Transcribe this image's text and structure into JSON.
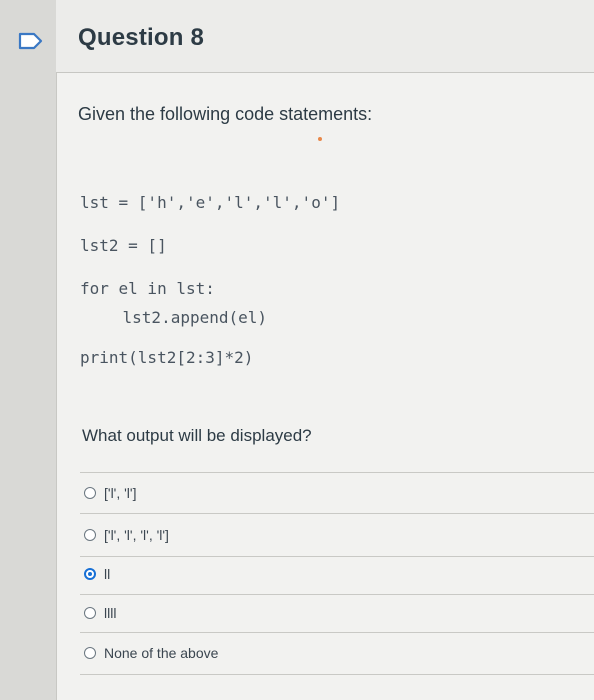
{
  "question": {
    "title": "Question 8",
    "prompt": "Given the following code statements:",
    "code_lines": [
      "lst = ['h','e','l','l','o']",
      "lst2 = []",
      "for el in lst:",
      "    lst2.append(el)",
      "print(lst2[2:3]*2)"
    ],
    "ask": "What output will be displayed?"
  },
  "answers": [
    {
      "label": "['l', 'l']",
      "selected": false
    },
    {
      "label": "['l', 'l', 'l', 'l']",
      "selected": false
    },
    {
      "label": "ll",
      "selected": true
    },
    {
      "label": "llll",
      "selected": false
    },
    {
      "label": "None of the above",
      "selected": false
    }
  ],
  "colors": {
    "accent": "#1770d6",
    "text": "#2d3b45"
  },
  "icons": {
    "flag": "flag-icon"
  }
}
